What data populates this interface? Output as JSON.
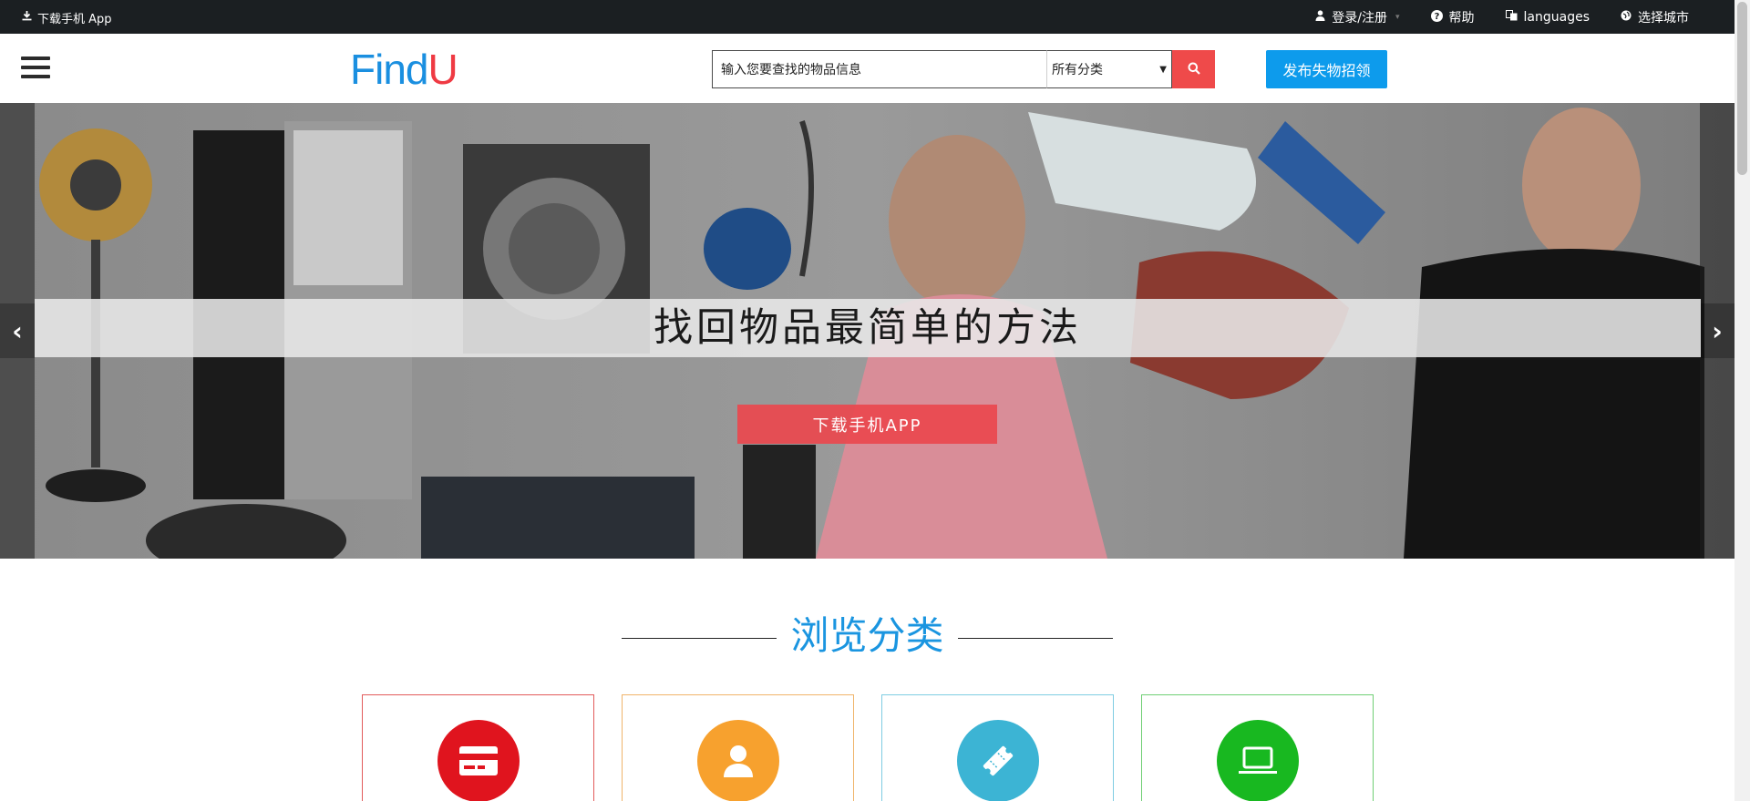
{
  "topbar": {
    "download_app": "下载手机 App",
    "login": "登录/注册",
    "help": "帮助",
    "languages": "languages",
    "city": "选择城市"
  },
  "header": {
    "logo_left": "Find",
    "logo_right": "U",
    "search_value": "输入您要查找的物品信息",
    "category_select": "所有分类",
    "post_button": "发布失物招领"
  },
  "hero": {
    "title": "找回物品最简单的方法",
    "download_button": "下载手机APP",
    "prev": "‹",
    "next": "›"
  },
  "categories": {
    "title": "浏览分类",
    "cards": [
      {
        "icon": "card-icon",
        "color": "#e0141e",
        "border": "#e25b5b"
      },
      {
        "icon": "person-icon",
        "color": "#f7a12e",
        "border": "#f0b46a"
      },
      {
        "icon": "ticket-icon",
        "color": "#3cb4d4",
        "border": "#7fcde2"
      },
      {
        "icon": "laptop-icon",
        "color": "#18b820",
        "border": "#6fcf74"
      }
    ]
  },
  "colors": {
    "topbar_bg": "#1b1f22",
    "accent_blue": "#0d9bec",
    "accent_red": "#ef4a4a"
  }
}
